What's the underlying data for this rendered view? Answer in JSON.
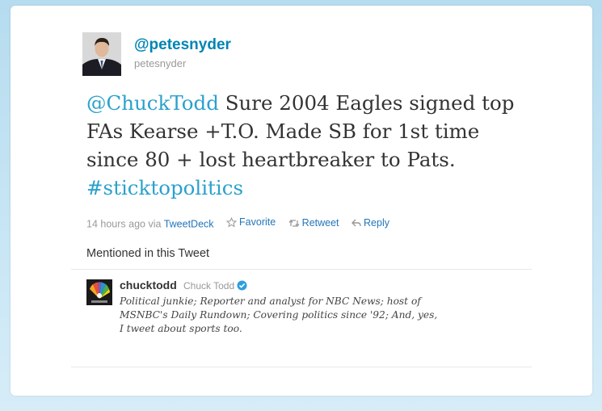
{
  "tweet": {
    "author_handle": "@petesnyder",
    "author_username": "petesnyder",
    "mention": "@ChuckTodd",
    "text_body": " Sure 2004 Eagles signed top FAs Kearse +T.O. Made SB for 1st time since 80 + lost heartbreaker to Pats.",
    "hashtag": "#sticktopolitics",
    "timestamp": "14 hours ago",
    "via_label": "via",
    "client": "TweetDeck",
    "actions": {
      "favorite": "Favorite",
      "retweet": "Retweet",
      "reply": "Reply"
    }
  },
  "mentioned": {
    "title": "Mentioned in this Tweet",
    "user": {
      "handle": "chucktodd",
      "name": "Chuck Todd",
      "verified_icon": "verified-badge-icon",
      "bio": "Political junkie; Reporter and analyst for NBC News; host of MSNBC's Daily Rundown; Covering politics since '92; And, yes, I tweet about sports too."
    }
  },
  "colors": {
    "link": "#0084b4",
    "text": "#333333",
    "muted": "#999999",
    "verified": "#2d9ee0"
  }
}
